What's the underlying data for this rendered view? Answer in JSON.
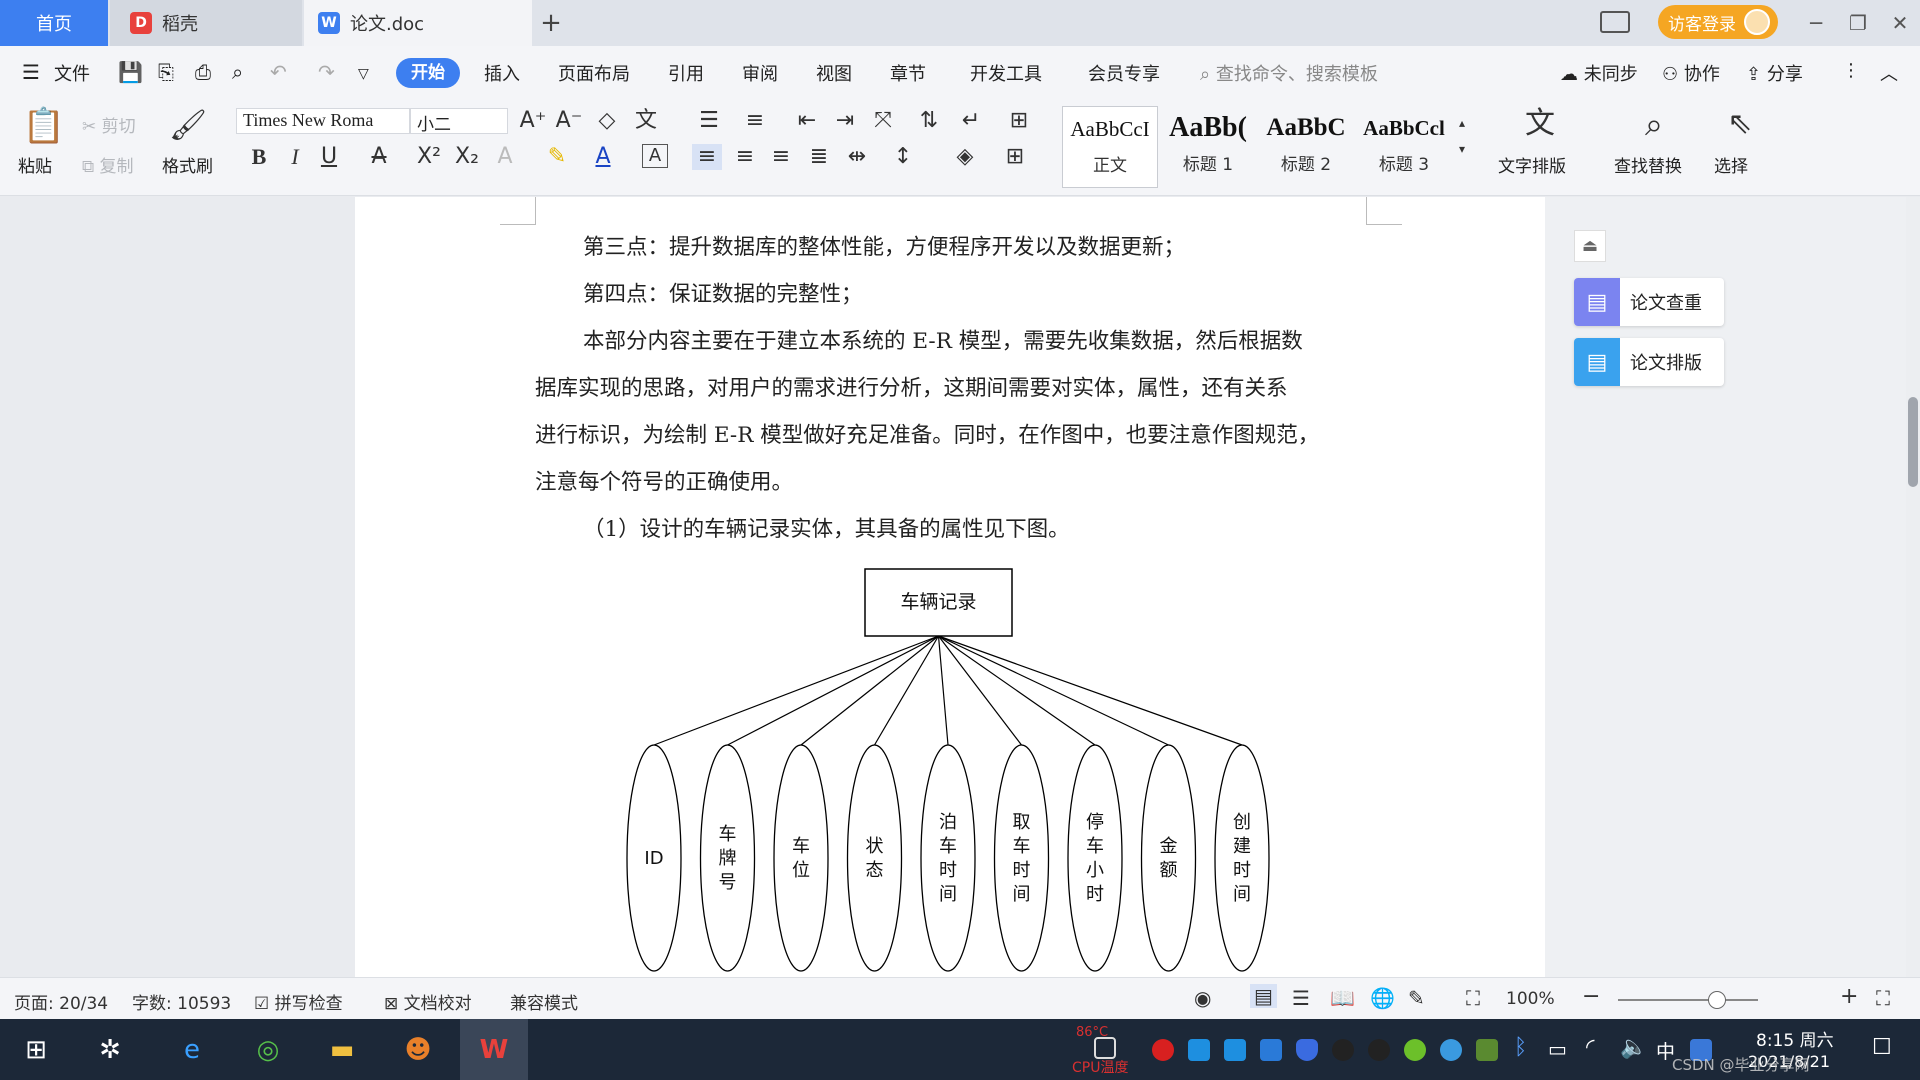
{
  "tabs": {
    "home": "首页",
    "daoke": "稻壳",
    "doc": "论文.doc",
    "add": "+"
  },
  "titlebar": {
    "login": "访客登录",
    "min": "─",
    "restore": "❐",
    "close": "✕"
  },
  "menu": {
    "file": "文件",
    "items": [
      "开始",
      "插入",
      "页面布局",
      "引用",
      "审阅",
      "视图",
      "章节",
      "开发工具",
      "会员专享"
    ],
    "search_placeholder": "查找命令、搜索模板",
    "unsynced": "未同步",
    "collab": "协作",
    "share": "分享"
  },
  "ribbon": {
    "paste": "粘贴",
    "cut": "剪切",
    "copy": "复制",
    "format_painter": "格式刷",
    "font_name": "Times New Roma",
    "font_size": "小二",
    "styles": [
      {
        "preview": "AaBbCcI",
        "name": "正文"
      },
      {
        "preview": "AaBb(",
        "name": "标题 1"
      },
      {
        "preview": "AaBbC",
        "name": "标题 2"
      },
      {
        "preview": "AaBbCcl",
        "name": "标题 3"
      }
    ],
    "text_layout": "文字排版",
    "find_replace": "查找替换",
    "select": "选择"
  },
  "document": {
    "paragraphs": [
      "第三点：提升数据库的整体性能，方便程序开发以及数据更新；",
      "第四点：保证数据的完整性；",
      "本部分内容主要在于建立本系统的 E-R 模型，需要先收集数据，然后根据数",
      "据库实现的思路，对用户的需求进行分析，这期间需要对实体，属性，还有关系",
      "进行标识，为绘制 E-R 模型做好充足准备。同时，在作图中，也要注意作图规范，",
      "注意每个符号的正确使用。",
      "（1）设计的车辆记录实体，其具备的属性见下图。"
    ],
    "entity": "车辆记录",
    "attributes": [
      "ID",
      "车牌号",
      "车位",
      "状态",
      "泊车时间",
      "取车时间",
      "停车小时",
      "金额",
      "创建时间"
    ]
  },
  "sidepanel": {
    "check": "论文查重",
    "layout": "论文排版"
  },
  "statusbar": {
    "page": "页面: 20/34",
    "words": "字数: 10593",
    "spell": "拼写检查",
    "proof": "文档校对",
    "compat": "兼容模式",
    "zoom": "100%"
  },
  "taskbar": {
    "temp": "86°C",
    "temp_label": "CPU温度",
    "time": "8:15 周六",
    "date": "2021/8/21",
    "ime": "中",
    "watermark": "CSDN @毕业分享网"
  }
}
